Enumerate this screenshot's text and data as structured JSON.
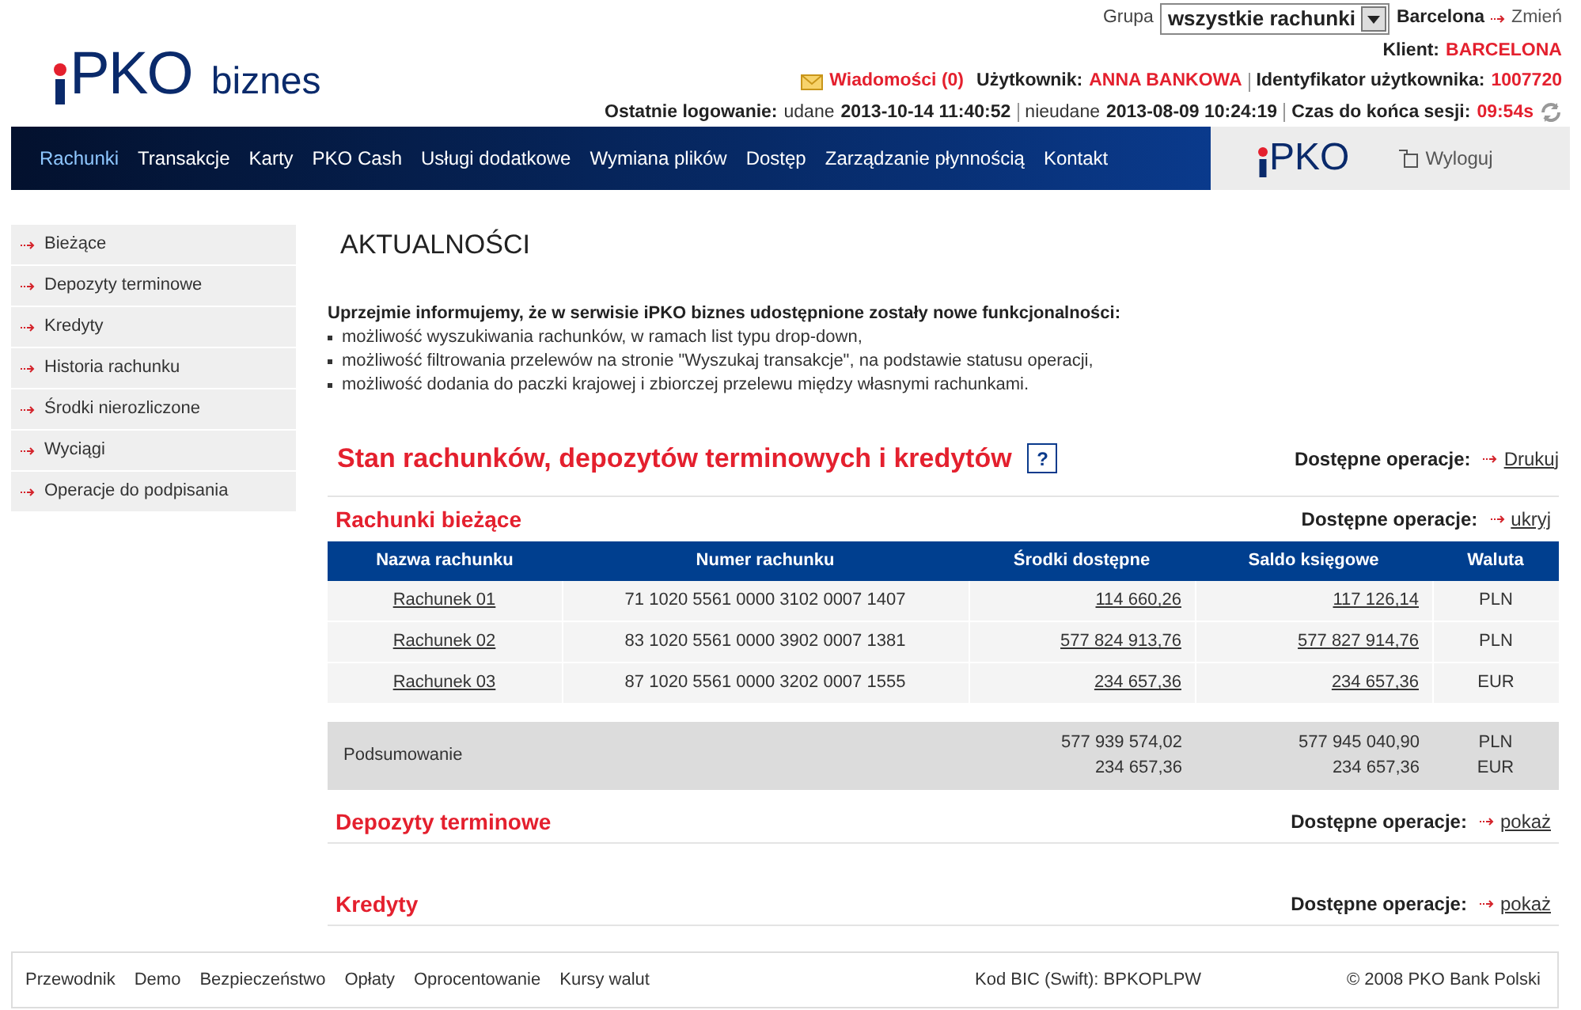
{
  "header": {
    "logo": {
      "brand": "PKO",
      "suffix": "biznes"
    },
    "group_label": "Grupa",
    "group_select": {
      "value": "wszystkie rachunki"
    },
    "company": "Barcelona",
    "change_link": "Zmień",
    "client_label": "Klient:",
    "client": "BARCELONA",
    "messages": "Wiadomości (0)",
    "user_label": "Użytkownik:",
    "user": "ANNA BANKOWA",
    "user_id_label": "Identyfikator użytkownika:",
    "user_id": "1007720",
    "last_login_label": "Ostatnie logowanie:",
    "success_label": "udane",
    "success_time": "2013-10-14 11:40:52",
    "failed_label": "nieudane",
    "failed_time": "2013-08-09 10:24:19",
    "session_label": "Czas do końca sesji:",
    "session_time": "09:54s"
  },
  "nav": {
    "items": [
      {
        "label": "Rachunki",
        "selected": true
      },
      {
        "label": "Transakcje",
        "selected": false
      },
      {
        "label": "Karty",
        "selected": false
      },
      {
        "label": "PKO Cash",
        "selected": false
      },
      {
        "label": "Usługi dodatkowe",
        "selected": false
      },
      {
        "label": "Wymiana plików",
        "selected": false
      },
      {
        "label": "Dostęp",
        "selected": false
      },
      {
        "label": "Zarządzanie płynnością",
        "selected": false
      },
      {
        "label": "Kontakt",
        "selected": false
      }
    ],
    "logo": "PKO",
    "logout": "Wyloguj"
  },
  "sidebar": {
    "items": [
      "Bieżące",
      "Depozyty terminowe",
      "Kredyty",
      "Historia rachunku",
      "Środki nierozliczone",
      "Wyciągi",
      "Operacje do podpisania"
    ]
  },
  "news": {
    "title": "AKTUALNOŚCI",
    "intro": "Uprzejmie informujemy, że w serwisie iPKO biznes udostępnione zostały nowe funkcjonalności:",
    "bullets": [
      "możliwość wyszukiwania rachunków, w ramach list typu drop-down,",
      "możliwość filtrowania przelewów na stronie \"Wyszukaj transakcje\", na podstawie statusu operacji,",
      "możliwość dodania do paczki krajowej i zbiorczej przelewu między własnymi rachunkami."
    ]
  },
  "overview": {
    "title": "Stan rachunków, depozytów terminowych i kredytów",
    "help": "?",
    "ops_label": "Dostępne operacje:",
    "ops_link": "Drukuj"
  },
  "accounts": {
    "title": "Rachunki bieżące",
    "ops_label": "Dostępne operacje:",
    "ops_link": "ukryj",
    "columns": [
      "Nazwa rachunku",
      "Numer rachunku",
      "Środki dostępne",
      "Saldo księgowe",
      "Waluta"
    ],
    "rows": [
      {
        "name": "Rachunek 01",
        "number": "71 1020 5561 0000 3102 0007 1407",
        "available": "114 660,26",
        "balance": "117 126,14",
        "currency": "PLN"
      },
      {
        "name": "Rachunek 02",
        "number": "83 1020 5561 0000 3902 0007 1381",
        "available": "577 824 913,76",
        "balance": "577 827 914,76",
        "currency": "PLN"
      },
      {
        "name": "Rachunek 03",
        "number": "87 1020 5561 0000 3202 0007 1555",
        "available": "234 657,36",
        "balance": "234 657,36",
        "currency": "EUR"
      }
    ],
    "summary": {
      "label": "Podsumowanie",
      "available": [
        "577 939 574,02",
        "234 657,36"
      ],
      "balance": [
        "577 945 040,90",
        "234 657,36"
      ],
      "currency": [
        "PLN",
        "EUR"
      ]
    }
  },
  "sections": [
    {
      "title": "Depozyty terminowe",
      "ops_label": "Dostępne operacje:",
      "ops_link": "pokaż"
    },
    {
      "title": "Kredyty",
      "ops_label": "Dostępne operacje:",
      "ops_link": "pokaż"
    }
  ],
  "footer": {
    "links": [
      "Przewodnik",
      "Demo",
      "Bezpieczeństwo",
      "Opłaty",
      "Oprocentowanie",
      "Kursy walut"
    ],
    "bic": "Kod BIC (Swift): BPKOPLPW",
    "copyright": "© 2008 PKO Bank Polski"
  }
}
